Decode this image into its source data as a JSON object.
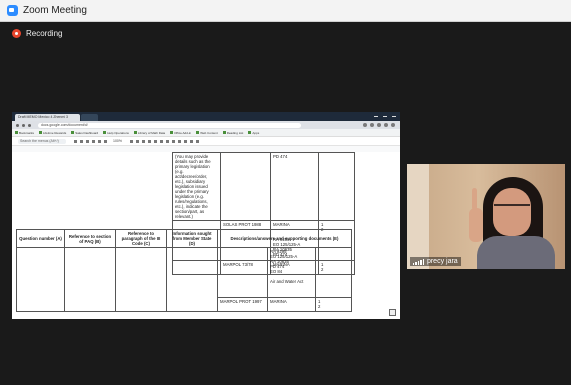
{
  "window": {
    "title": "Zoom Meeting"
  },
  "recording": {
    "label": "Recording"
  },
  "browser": {
    "tab_title": "Draft MEMO Mexico 4 Zhenmi 3",
    "url": "docs.google.com/document/d/",
    "bookmarks": [
      "Bookmarks",
      "Lifetime Rewards",
      "Sales Dashboard",
      "Help Operations",
      "Library of Math Data",
      "Office Add-in",
      "Web Content",
      "Reading List",
      "Apps"
    ],
    "doc_search_placeholder": "Search the menus (Alt+/)",
    "zoom": "100%"
  },
  "doc": {
    "top_table": {
      "rows": [
        {
          "info": [
            "(You may provide",
            "details such as the",
            "primary legislation",
            "(e.g.",
            "act/decree/order,",
            "etc.), subsidiary",
            "legislation issued",
            "under the primary",
            "legislation (e.g.",
            "rules/regulations,",
            "etc.), indicate the",
            "section/part, as",
            "relevant.)"
          ],
          "instrument": "",
          "agency": [
            "PD 474"
          ],
          "num": []
        },
        {
          "info": [],
          "instrument": "SOLAS PROT 1988",
          "agency": [
            "MARINA",
            "",
            "",
            "RA 9295",
            "EO 125/125-A",
            "RA 10635",
            "PD 474"
          ],
          "num": [
            "1",
            "2"
          ]
        },
        {
          "info": [],
          "instrument": "MARPOL 73/78",
          "agency": [
            "MARINA"
          ],
          "num": [
            "1",
            "2"
          ]
        }
      ]
    },
    "main_table": {
      "headers": [
        "Question number (A)",
        "Reference to section of PAQ (B)",
        "Reference to paragraph of the III Code (C)",
        "Information sought from Member State (D)",
        "Descriptions/answers and supporting documents (E)"
      ],
      "body": {
        "agency_block_1": [
          "RA 9295",
          "EO 125/125-A",
          "RA 10635",
          "PD 474",
          "EO 84",
          "",
          "Air and Water Act"
        ],
        "instrument_2": "MARPOL PROT 1997",
        "agency_2": [
          "MARINA"
        ],
        "num_2": [
          "1",
          "2"
        ]
      }
    }
  },
  "participant": {
    "name": "precy jara"
  }
}
